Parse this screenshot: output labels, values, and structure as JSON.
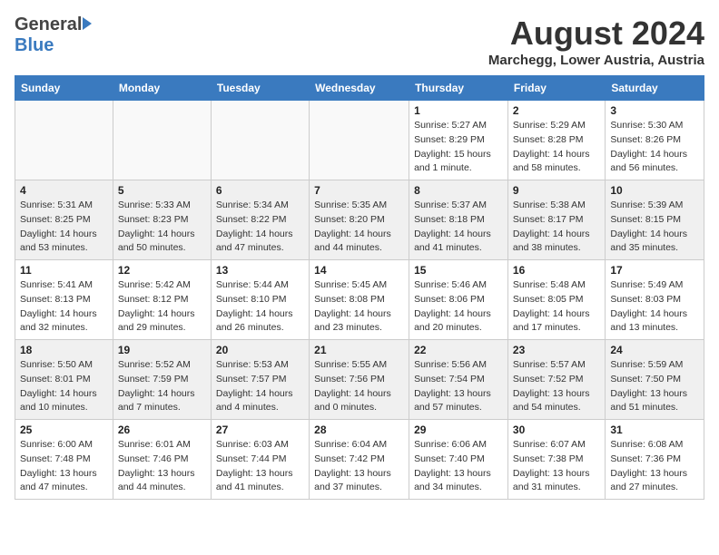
{
  "header": {
    "logo_general": "General",
    "logo_blue": "Blue",
    "month_title": "August 2024",
    "location": "Marchegg, Lower Austria, Austria"
  },
  "weekdays": [
    "Sunday",
    "Monday",
    "Tuesday",
    "Wednesday",
    "Thursday",
    "Friday",
    "Saturday"
  ],
  "weeks": [
    [
      {
        "day": "",
        "info": ""
      },
      {
        "day": "",
        "info": ""
      },
      {
        "day": "",
        "info": ""
      },
      {
        "day": "",
        "info": ""
      },
      {
        "day": "1",
        "info": "Sunrise: 5:27 AM\nSunset: 8:29 PM\nDaylight: 15 hours\nand 1 minute."
      },
      {
        "day": "2",
        "info": "Sunrise: 5:29 AM\nSunset: 8:28 PM\nDaylight: 14 hours\nand 58 minutes."
      },
      {
        "day": "3",
        "info": "Sunrise: 5:30 AM\nSunset: 8:26 PM\nDaylight: 14 hours\nand 56 minutes."
      }
    ],
    [
      {
        "day": "4",
        "info": "Sunrise: 5:31 AM\nSunset: 8:25 PM\nDaylight: 14 hours\nand 53 minutes."
      },
      {
        "day": "5",
        "info": "Sunrise: 5:33 AM\nSunset: 8:23 PM\nDaylight: 14 hours\nand 50 minutes."
      },
      {
        "day": "6",
        "info": "Sunrise: 5:34 AM\nSunset: 8:22 PM\nDaylight: 14 hours\nand 47 minutes."
      },
      {
        "day": "7",
        "info": "Sunrise: 5:35 AM\nSunset: 8:20 PM\nDaylight: 14 hours\nand 44 minutes."
      },
      {
        "day": "8",
        "info": "Sunrise: 5:37 AM\nSunset: 8:18 PM\nDaylight: 14 hours\nand 41 minutes."
      },
      {
        "day": "9",
        "info": "Sunrise: 5:38 AM\nSunset: 8:17 PM\nDaylight: 14 hours\nand 38 minutes."
      },
      {
        "day": "10",
        "info": "Sunrise: 5:39 AM\nSunset: 8:15 PM\nDaylight: 14 hours\nand 35 minutes."
      }
    ],
    [
      {
        "day": "11",
        "info": "Sunrise: 5:41 AM\nSunset: 8:13 PM\nDaylight: 14 hours\nand 32 minutes."
      },
      {
        "day": "12",
        "info": "Sunrise: 5:42 AM\nSunset: 8:12 PM\nDaylight: 14 hours\nand 29 minutes."
      },
      {
        "day": "13",
        "info": "Sunrise: 5:44 AM\nSunset: 8:10 PM\nDaylight: 14 hours\nand 26 minutes."
      },
      {
        "day": "14",
        "info": "Sunrise: 5:45 AM\nSunset: 8:08 PM\nDaylight: 14 hours\nand 23 minutes."
      },
      {
        "day": "15",
        "info": "Sunrise: 5:46 AM\nSunset: 8:06 PM\nDaylight: 14 hours\nand 20 minutes."
      },
      {
        "day": "16",
        "info": "Sunrise: 5:48 AM\nSunset: 8:05 PM\nDaylight: 14 hours\nand 17 minutes."
      },
      {
        "day": "17",
        "info": "Sunrise: 5:49 AM\nSunset: 8:03 PM\nDaylight: 14 hours\nand 13 minutes."
      }
    ],
    [
      {
        "day": "18",
        "info": "Sunrise: 5:50 AM\nSunset: 8:01 PM\nDaylight: 14 hours\nand 10 minutes."
      },
      {
        "day": "19",
        "info": "Sunrise: 5:52 AM\nSunset: 7:59 PM\nDaylight: 14 hours\nand 7 minutes."
      },
      {
        "day": "20",
        "info": "Sunrise: 5:53 AM\nSunset: 7:57 PM\nDaylight: 14 hours\nand 4 minutes."
      },
      {
        "day": "21",
        "info": "Sunrise: 5:55 AM\nSunset: 7:56 PM\nDaylight: 14 hours\nand 0 minutes."
      },
      {
        "day": "22",
        "info": "Sunrise: 5:56 AM\nSunset: 7:54 PM\nDaylight: 13 hours\nand 57 minutes."
      },
      {
        "day": "23",
        "info": "Sunrise: 5:57 AM\nSunset: 7:52 PM\nDaylight: 13 hours\nand 54 minutes."
      },
      {
        "day": "24",
        "info": "Sunrise: 5:59 AM\nSunset: 7:50 PM\nDaylight: 13 hours\nand 51 minutes."
      }
    ],
    [
      {
        "day": "25",
        "info": "Sunrise: 6:00 AM\nSunset: 7:48 PM\nDaylight: 13 hours\nand 47 minutes."
      },
      {
        "day": "26",
        "info": "Sunrise: 6:01 AM\nSunset: 7:46 PM\nDaylight: 13 hours\nand 44 minutes."
      },
      {
        "day": "27",
        "info": "Sunrise: 6:03 AM\nSunset: 7:44 PM\nDaylight: 13 hours\nand 41 minutes."
      },
      {
        "day": "28",
        "info": "Sunrise: 6:04 AM\nSunset: 7:42 PM\nDaylight: 13 hours\nand 37 minutes."
      },
      {
        "day": "29",
        "info": "Sunrise: 6:06 AM\nSunset: 7:40 PM\nDaylight: 13 hours\nand 34 minutes."
      },
      {
        "day": "30",
        "info": "Sunrise: 6:07 AM\nSunset: 7:38 PM\nDaylight: 13 hours\nand 31 minutes."
      },
      {
        "day": "31",
        "info": "Sunrise: 6:08 AM\nSunset: 7:36 PM\nDaylight: 13 hours\nand 27 minutes."
      }
    ]
  ]
}
